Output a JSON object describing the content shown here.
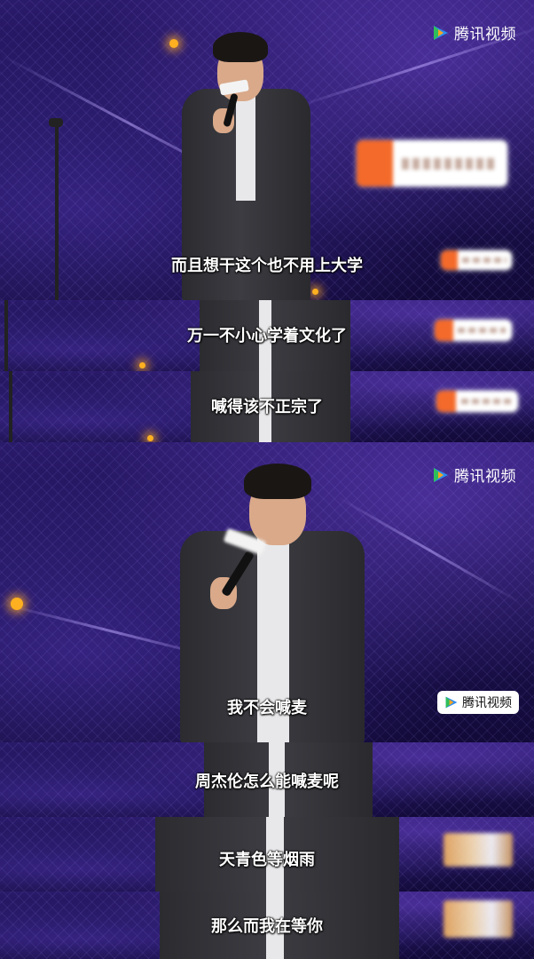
{
  "brand": {
    "logo_text": "腾讯视频",
    "logo_icon": "tencent-video-play-icon",
    "colors": {
      "green": "#2fbf5a",
      "blue": "#2c8cf0",
      "orange": "#f6a623"
    }
  },
  "panels": [
    {
      "subtitle": "而且想干这个也不用上大学"
    },
    {
      "subtitle": "万一不小心学着文化了"
    },
    {
      "subtitle": "喊得该不正宗了"
    },
    {
      "subtitle": "我不会喊麦"
    },
    {
      "subtitle": "周杰伦怎么能喊麦呢"
    },
    {
      "subtitle": "天青色等烟雨"
    },
    {
      "subtitle": "那么而我在等你"
    }
  ],
  "watermark_badge": {
    "text": "腾讯视频",
    "icon": "tencent-video-play-icon"
  }
}
